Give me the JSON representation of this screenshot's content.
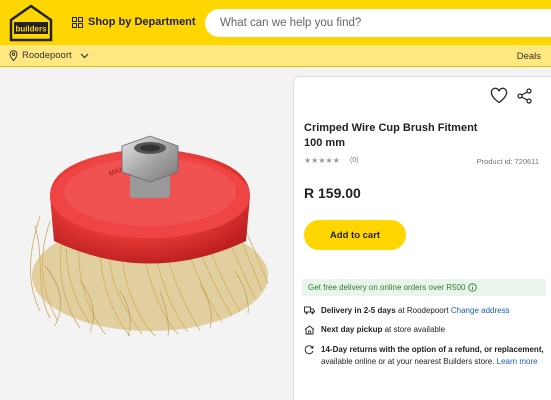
{
  "header": {
    "logo_text": "builders",
    "dept_label": "Shop by Department",
    "search_placeholder": "What can we help you find?"
  },
  "subbar": {
    "location": "Roodepoort",
    "deals": "Deals"
  },
  "product": {
    "title": "Crimped Wire Cup Brush Fitment 100 mm",
    "stars": "★★★★★",
    "review_count": "(0)",
    "product_id": "Product id: 720611",
    "price": "R 159.00",
    "add_to_cart": "Add to cart",
    "delivery_banner": "Get free delivery on online orders over R500",
    "delivery": {
      "bold": "Delivery in 2-5 days",
      "rest": " at Roodepoort ",
      "link": "Change address"
    },
    "pickup": {
      "bold": "Next day pickup",
      "rest": " at store available"
    },
    "returns": {
      "bold": "14-Day returns with the option of a refund, or replacement,",
      "rest": " available online or at your nearest Builders store. ",
      "link": "Learn more"
    }
  },
  "colors": {
    "brand_yellow": "#ffd600",
    "link_blue": "#1a5fb4",
    "success_green": "#2e7d32"
  }
}
